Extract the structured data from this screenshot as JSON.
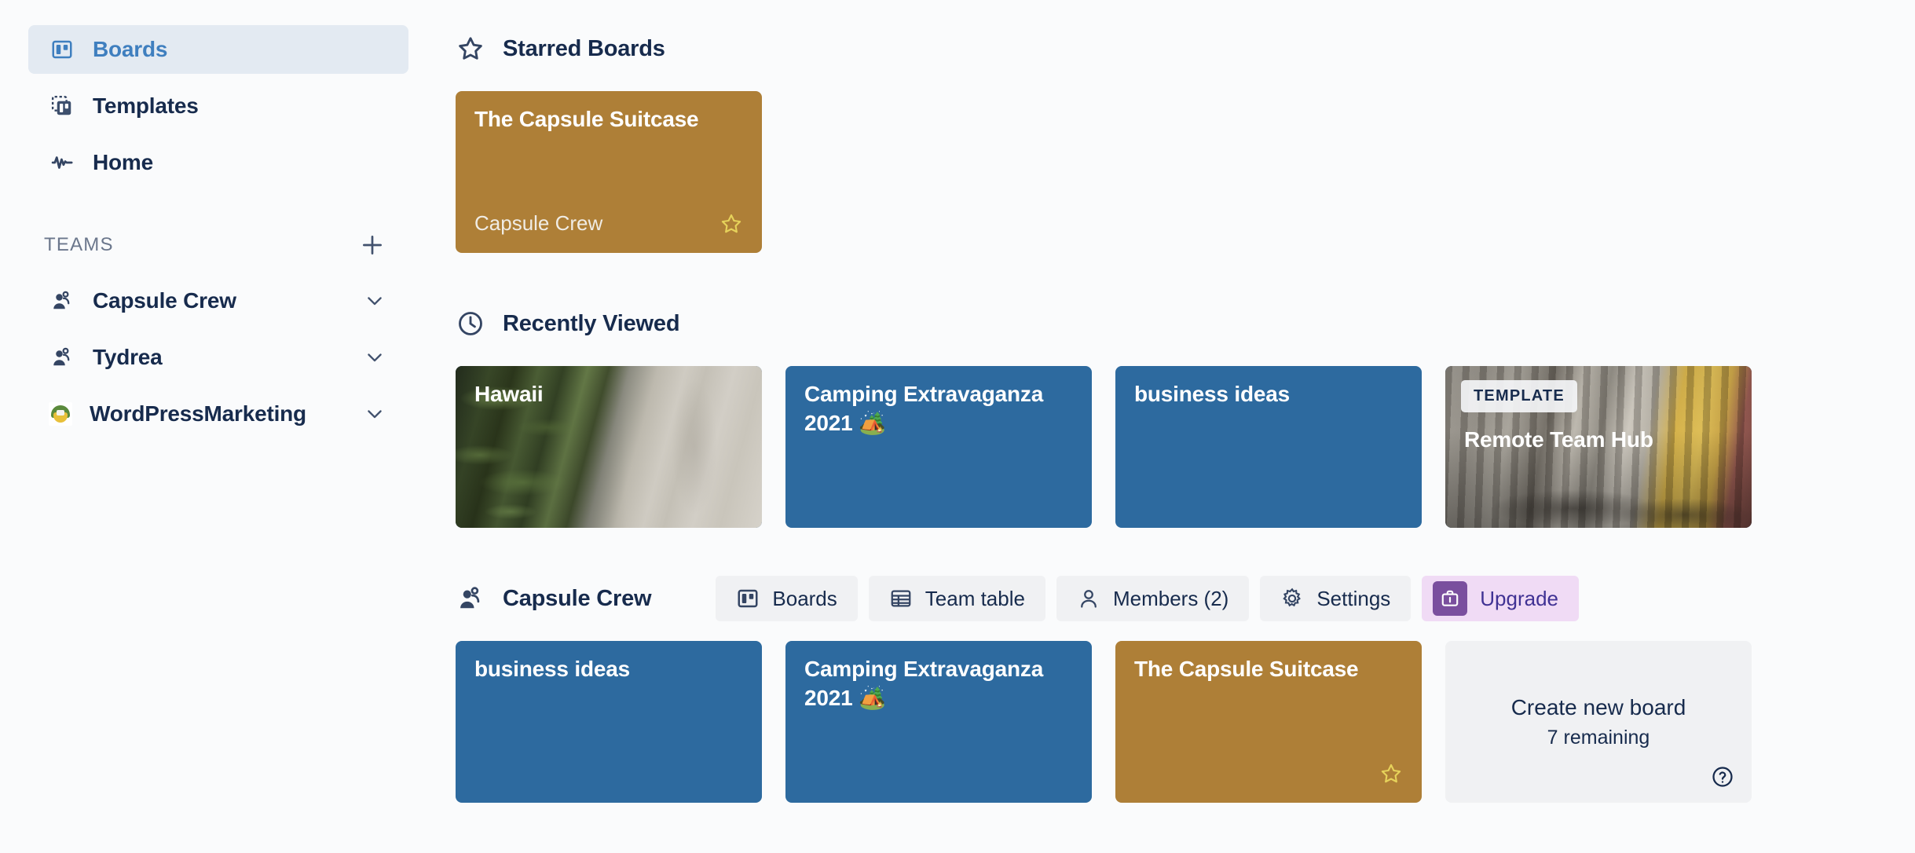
{
  "sidebar": {
    "nav": [
      {
        "label": "Boards",
        "icon": "board-icon",
        "active": true
      },
      {
        "label": "Templates",
        "icon": "templates-icon",
        "active": false
      },
      {
        "label": "Home",
        "icon": "activity-icon",
        "active": false
      }
    ],
    "teams_label": "TEAMS",
    "add_team_icon": "plus-icon",
    "teams": [
      {
        "label": "Capsule Crew",
        "icon": "team-people-icon",
        "chevron": "chevron-down-icon"
      },
      {
        "label": "Tydrea",
        "icon": "team-people-icon",
        "chevron": "chevron-down-icon"
      },
      {
        "label": "WordPressMarketing",
        "icon": "team-avatar-image",
        "chevron": "chevron-down-icon"
      }
    ]
  },
  "starred": {
    "icon": "star-outline-icon",
    "title": "Starred Boards",
    "boards": [
      {
        "title": "The Capsule Suitcase",
        "team": "Capsule Crew",
        "color": "#ae7f37",
        "starred": true,
        "star_icon": "star-icon"
      }
    ]
  },
  "recent": {
    "icon": "clock-icon",
    "title": "Recently Viewed",
    "boards": [
      {
        "title": "Hawaii",
        "style": "photo-hawaii",
        "badge": null
      },
      {
        "title": "Camping Extravaganza 2021 🏕️",
        "style": "blue",
        "color": "#2d6a9f",
        "badge": null
      },
      {
        "title": "business ideas",
        "style": "blue",
        "color": "#2d6a9f",
        "badge": null
      },
      {
        "title": "Remote Team Hub",
        "style": "photo-train",
        "badge": "TEMPLATE"
      }
    ]
  },
  "team_section": {
    "icon": "team-people-icon",
    "title": "Capsule Crew",
    "actions": [
      {
        "label": "Boards",
        "icon": "board-icon",
        "variant": "default"
      },
      {
        "label": "Team table",
        "icon": "table-icon",
        "variant": "default"
      },
      {
        "label": "Members (2)",
        "icon": "person-icon",
        "variant": "default"
      },
      {
        "label": "Settings",
        "icon": "gear-icon",
        "variant": "default"
      },
      {
        "label": "Upgrade",
        "icon": "briefcase-icon",
        "variant": "upgrade"
      }
    ],
    "boards": [
      {
        "title": "business ideas",
        "style": "blue",
        "color": "#2d6a9f",
        "starred": false
      },
      {
        "title": "Camping Extravaganza 2021 🏕️",
        "style": "blue",
        "color": "#2d6a9f",
        "starred": false
      },
      {
        "title": "The Capsule Suitcase",
        "style": "gold",
        "color": "#ae7f37",
        "starred": true,
        "star_icon": "star-icon"
      }
    ],
    "create": {
      "title": "Create new board",
      "subtitle": "7 remaining",
      "help_icon": "help-circle-icon"
    }
  },
  "colors": {
    "page_bg": "#fafbfc",
    "active_nav_bg": "#e3eaf2",
    "active_nav_text": "#3f7fbf",
    "text_primary": "#172b4d",
    "text_muted": "#6b778c",
    "board_blue": "#2d6a9f",
    "board_gold": "#ae7f37",
    "upgrade_bg": "#f0dbf5",
    "upgrade_accent": "#7a4f9e",
    "star_yellow": "#e6d25a"
  }
}
